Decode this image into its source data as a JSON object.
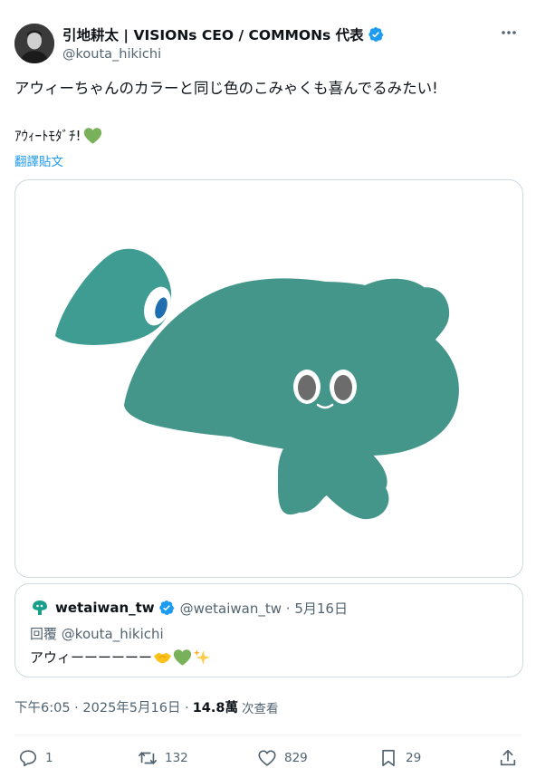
{
  "author": {
    "display_name": "引地耕太 | VISIONs CEO / COMMONs 代表",
    "handle": "@kouta_hikichi",
    "verified": true
  },
  "tweet": {
    "text_line1": "アウィーちゃんのカラーと同じ色のこみゃくも喜んでるみたい!",
    "text_line2": "ｱｳｨｰﾄﾓﾀﾞﾁ!",
    "heart_emoji": "green-heart",
    "translate_label": "翻譯貼文"
  },
  "media": {
    "character_color": "#44958a",
    "left_blob_color": "#3f9c93",
    "eye_color": "#6c6c6c"
  },
  "quote": {
    "name": "wetaiwan_tw",
    "handle_date": "@wetaiwan_tw · 5月16日",
    "reply_label": "回覆",
    "reply_mention": "@kouta_hikichi",
    "body": "アウィーーーーーー",
    "emojis": [
      "handshake",
      "green-heart",
      "sparkles"
    ]
  },
  "meta": {
    "timestamp": "下午6:05 · 2025年5月16日 ·",
    "views_count": "14.8萬",
    "views_label": "次查看"
  },
  "actions": {
    "reply_count": "1",
    "retweet_count": "132",
    "like_count": "829",
    "bookmark_count": "29"
  },
  "colors": {
    "accent": "#1d9bf0",
    "secondary_text": "#536471",
    "border": "#cfd9de"
  }
}
